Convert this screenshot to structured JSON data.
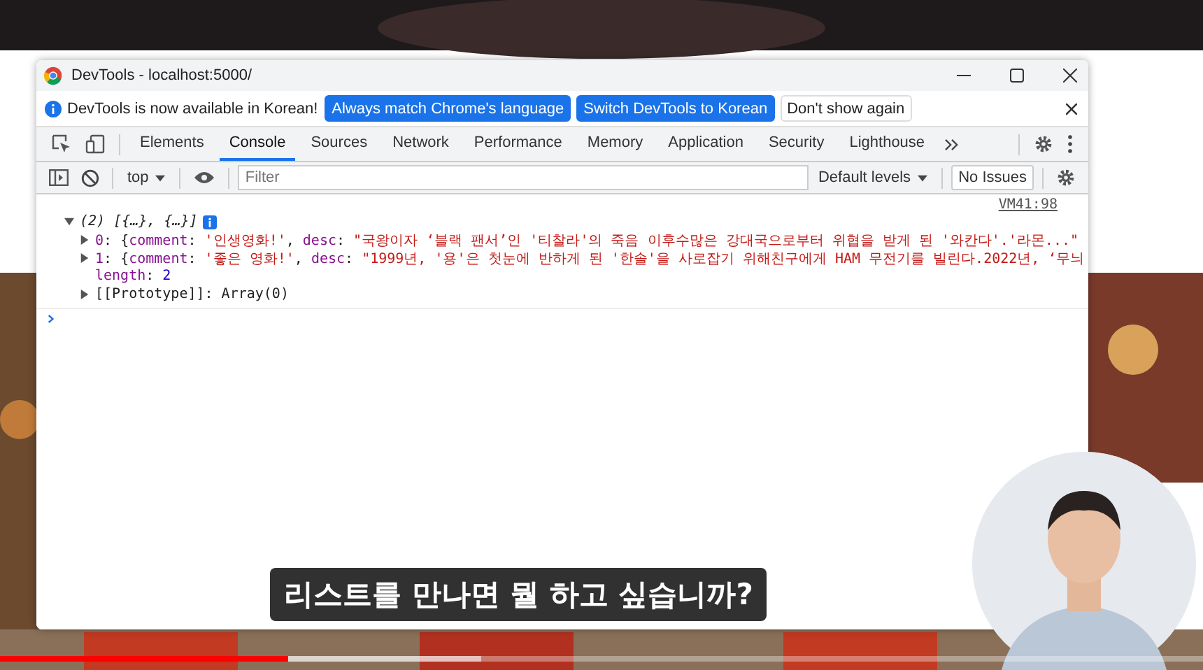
{
  "window": {
    "title": "DevTools - localhost:5000/"
  },
  "infobar": {
    "message": "DevTools is now available in Korean!",
    "buttons": [
      {
        "label": "Always match Chrome's language",
        "kind": "primary"
      },
      {
        "label": "Switch DevTools to Korean",
        "kind": "primary"
      },
      {
        "label": "Don't show again",
        "kind": "plain"
      }
    ]
  },
  "tabs": [
    {
      "label": "Elements",
      "selected": false
    },
    {
      "label": "Console",
      "selected": true
    },
    {
      "label": "Sources",
      "selected": false
    },
    {
      "label": "Network",
      "selected": false
    },
    {
      "label": "Performance",
      "selected": false
    },
    {
      "label": "Memory",
      "selected": false
    },
    {
      "label": "Application",
      "selected": false
    },
    {
      "label": "Security",
      "selected": false
    },
    {
      "label": "Lighthouse",
      "selected": false
    }
  ],
  "toolbar": {
    "context": "top",
    "filter": {
      "placeholder": "Filter"
    },
    "levels": "Default levels",
    "issues": "No Issues"
  },
  "console": {
    "source": "VM41:98",
    "summary": "(2) [{…}, {…}]",
    "expanded": true,
    "lines": [
      {
        "kind": "entry",
        "expanded": false,
        "tokens": [
          {
            "kind": "index",
            "text": "0"
          },
          {
            "kind": "plain",
            "text": ": {"
          },
          {
            "kind": "key",
            "text": "comment"
          },
          {
            "kind": "plain",
            "text": ": "
          },
          {
            "kind": "string",
            "text": "'인생영화!'"
          },
          {
            "kind": "plain",
            "text": ", "
          },
          {
            "kind": "key",
            "text": "desc"
          },
          {
            "kind": "plain",
            "text": ": "
          },
          {
            "kind": "string",
            "text": "\"국왕이자 ‘블랙 팬서’인 '티찰라'의 죽음 이후수많은 강대국으로부터 위협을 받게 된 '와칸다'.'라몬...\""
          }
        ]
      },
      {
        "kind": "entry",
        "expanded": false,
        "tokens": [
          {
            "kind": "index",
            "text": "1"
          },
          {
            "kind": "plain",
            "text": ": {"
          },
          {
            "kind": "key",
            "text": "comment"
          },
          {
            "kind": "plain",
            "text": ": "
          },
          {
            "kind": "string",
            "text": "'좋은 영화!'"
          },
          {
            "kind": "plain",
            "text": ", "
          },
          {
            "kind": "key",
            "text": "desc"
          },
          {
            "kind": "plain",
            "text": ": "
          },
          {
            "kind": "string",
            "text": "\"1999년, '용'은 첫눈에 반하게 된 '한솔'을 사로잡기 위해친구에게 HAM 무전기를 빌린다.2022년, ‘무늬"
          }
        ]
      },
      {
        "kind": "property",
        "tokens": [
          {
            "kind": "key",
            "text": "length"
          },
          {
            "kind": "plain",
            "text": ": "
          },
          {
            "kind": "number",
            "text": "2"
          }
        ]
      },
      {
        "kind": "entry",
        "expanded": false,
        "tokens": [
          {
            "kind": "plain",
            "text": "[[Prototype]]: Array(0)"
          }
        ]
      }
    ]
  },
  "caption": "리스트를 만나면 뭘 하고 싶습니까?",
  "video": {
    "level": 0.24
  }
}
